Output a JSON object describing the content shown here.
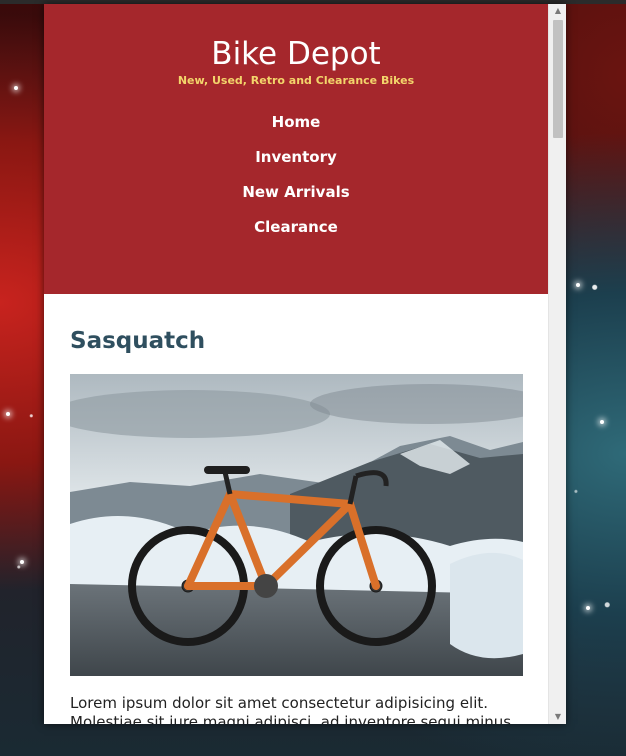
{
  "colors": {
    "brand": "#a5272c",
    "tagline": "#f3d56b",
    "title": "#2f4f5f"
  },
  "site": {
    "title": "Bike Depot",
    "tagline": "New, Used, Retro and Clearance Bikes"
  },
  "nav": {
    "items": [
      {
        "label": "Home"
      },
      {
        "label": "Inventory"
      },
      {
        "label": "New Arrivals"
      },
      {
        "label": "Clearance"
      }
    ]
  },
  "article": {
    "title": "Sasquatch",
    "image_icon": "bike-photo",
    "body": "Lorem ipsum dolor sit amet consectetur adipisicing elit. Molestiae sit iure magni adipisci, ad inventore sequi minus"
  },
  "scrollbar": {
    "up_icon": "chevron-up-icon",
    "down_icon": "chevron-down-icon"
  }
}
